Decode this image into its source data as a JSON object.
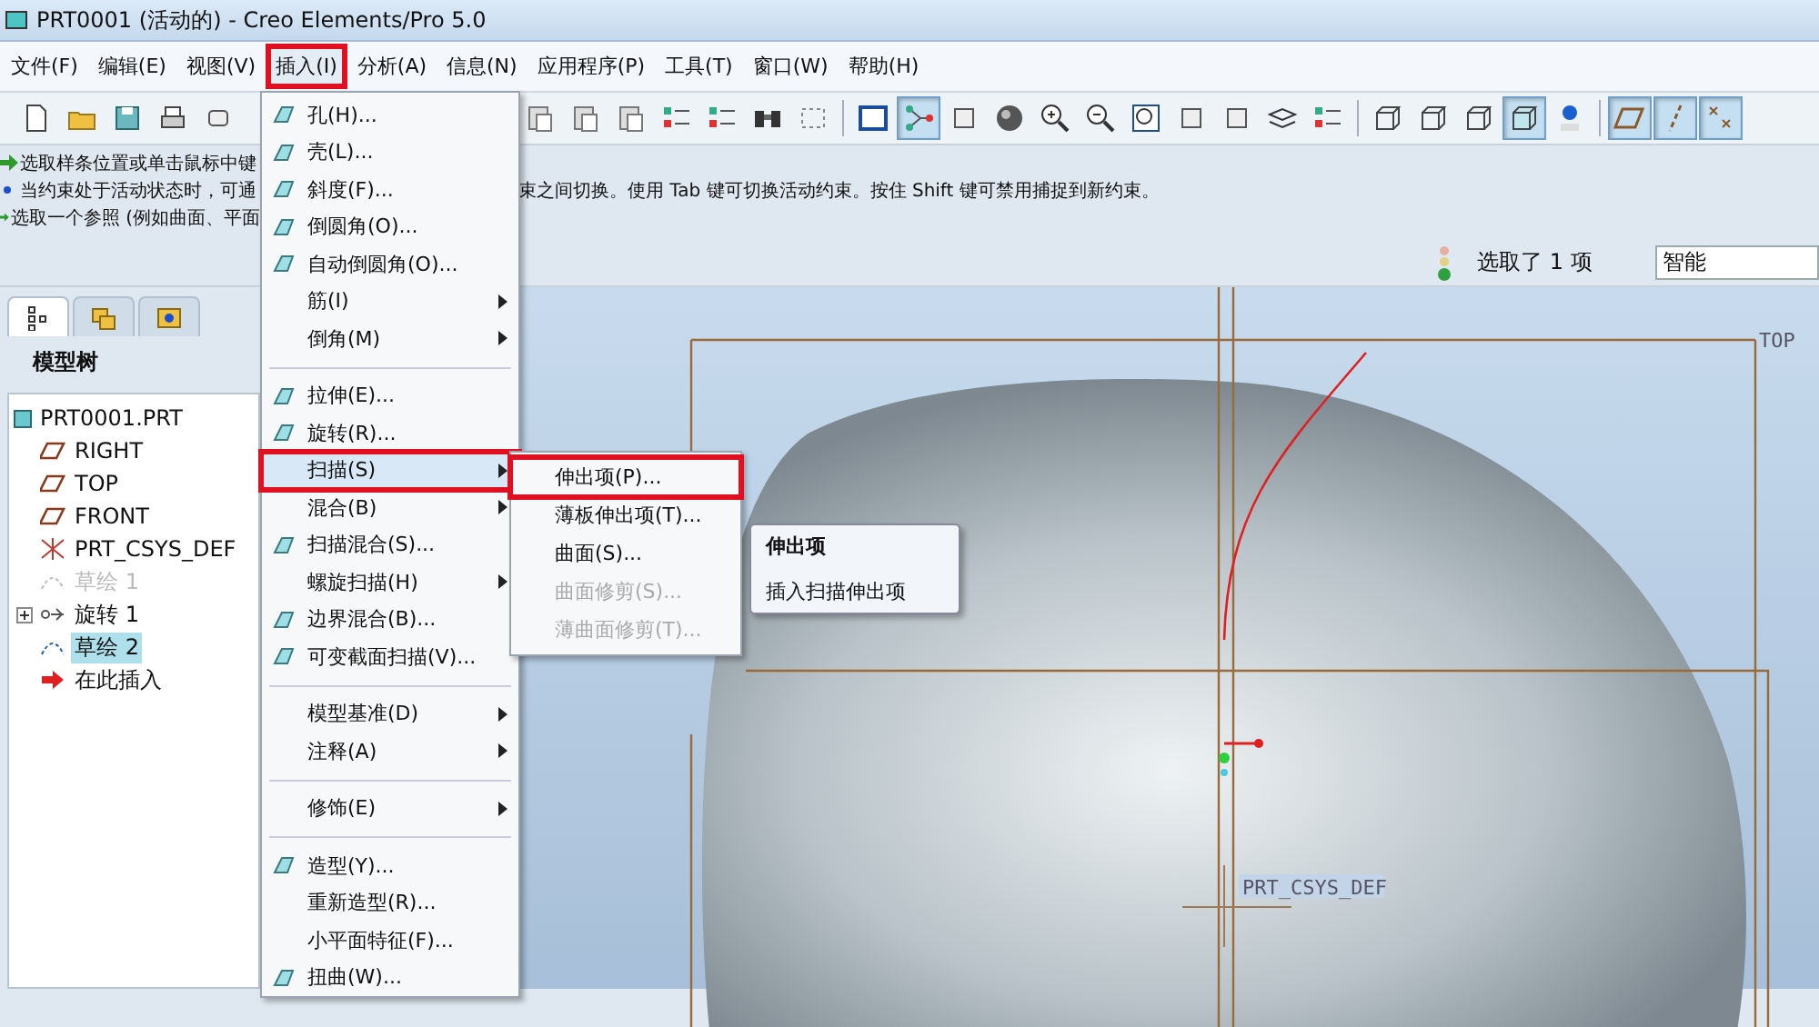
{
  "window": {
    "title": "PRT0001 (活动的) - Creo Elements/Pro 5.0"
  },
  "menubar": [
    {
      "label": "文件(F)",
      "selected": false,
      "annotated": false
    },
    {
      "label": "编辑(E)",
      "selected": false,
      "annotated": false
    },
    {
      "label": "视图(V)",
      "selected": false,
      "annotated": false
    },
    {
      "label": "插入(I)",
      "selected": true,
      "annotated": true
    },
    {
      "label": "分析(A)",
      "selected": false,
      "annotated": false
    },
    {
      "label": "信息(N)",
      "selected": false,
      "annotated": false
    },
    {
      "label": "应用程序(P)",
      "selected": false,
      "annotated": false
    },
    {
      "label": "工具(T)",
      "selected": false,
      "annotated": false
    },
    {
      "label": "窗口(W)",
      "selected": false,
      "annotated": false
    },
    {
      "label": "帮助(H)",
      "selected": false,
      "annotated": false
    }
  ],
  "toolbar_left": [
    {
      "kind": "doc",
      "pressed": false
    },
    {
      "kind": "folder",
      "pressed": false
    },
    {
      "kind": "disk",
      "pressed": false
    },
    {
      "kind": "printer",
      "pressed": false
    },
    {
      "kind": "generic",
      "pressed": false
    }
  ],
  "toolbar_right": [
    {
      "kind": "clipboard",
      "pressed": false
    },
    {
      "kind": "clipboard",
      "pressed": false
    },
    {
      "kind": "clipboard",
      "pressed": false
    },
    {
      "kind": "list",
      "pressed": false
    },
    {
      "kind": "list",
      "pressed": false
    },
    {
      "kind": "binoculars",
      "pressed": false
    },
    {
      "kind": "selectbox",
      "pressed": false
    },
    {
      "kind": "sep"
    },
    {
      "kind": "window",
      "pressed": false
    },
    {
      "kind": "datum",
      "pressed": true
    },
    {
      "kind": "generic",
      "pressed": false
    },
    {
      "kind": "sphere",
      "pressed": false
    },
    {
      "kind": "zoomin",
      "pressed": false
    },
    {
      "kind": "zoomout",
      "pressed": false
    },
    {
      "kind": "zoombox",
      "pressed": false
    },
    {
      "kind": "generic",
      "pressed": false
    },
    {
      "kind": "generic",
      "pressed": false
    },
    {
      "kind": "layers",
      "pressed": false
    },
    {
      "kind": "list",
      "pressed": false
    },
    {
      "kind": "sep"
    },
    {
      "kind": "cubewire",
      "pressed": false
    },
    {
      "kind": "cubewire",
      "pressed": false
    },
    {
      "kind": "cubewire",
      "pressed": false
    },
    {
      "kind": "cubeshaded",
      "pressed": true
    },
    {
      "kind": "pin",
      "pressed": false
    },
    {
      "kind": "sep"
    },
    {
      "kind": "plane",
      "pressed": true
    },
    {
      "kind": "axis",
      "pressed": true
    },
    {
      "kind": "point",
      "pressed": true
    }
  ],
  "messages": [
    {
      "kind": "arrow",
      "left": "选取样条位置或单击鼠标中键"
    },
    {
      "kind": "bullet",
      "left": "当约束处于活动状态时，可通",
      "right": "束之间切换。使用 Tab 键可切换活动约束。按住 Shift 键可禁用捕捉到新约束。"
    },
    {
      "kind": "arrow",
      "left": "选取一个参照 (例如曲面、平面"
    }
  ],
  "status": {
    "selection": "选取了 1 项",
    "filter": "智能"
  },
  "model_tree": {
    "tabs": [
      {
        "kind": "tree",
        "selected": true
      },
      {
        "kind": "folders",
        "selected": false
      },
      {
        "kind": "favorites",
        "selected": false
      }
    ],
    "title": "模型树",
    "root": {
      "label": "PRT0001.PRT",
      "children": [
        {
          "label": "RIGHT",
          "kind": "plane",
          "expandable": false,
          "selected": false,
          "suppressed": false
        },
        {
          "label": "TOP",
          "kind": "plane",
          "expandable": false,
          "selected": false,
          "suppressed": false
        },
        {
          "label": "FRONT",
          "kind": "plane",
          "expandable": false,
          "selected": false,
          "suppressed": false
        },
        {
          "label": "PRT_CSYS_DEF",
          "kind": "csys",
          "expandable": false,
          "selected": false,
          "suppressed": false
        },
        {
          "label": "草绘 1",
          "kind": "sketch",
          "expandable": false,
          "selected": false,
          "suppressed": true
        },
        {
          "label": "旋转 1",
          "kind": "revolve",
          "expandable": true,
          "selected": false,
          "suppressed": false
        },
        {
          "label": "草绘 2",
          "kind": "sketch",
          "expandable": false,
          "selected": true,
          "suppressed": false
        },
        {
          "label": "在此插入",
          "kind": "insert",
          "expandable": false,
          "selected": false,
          "suppressed": false
        }
      ]
    }
  },
  "insert_menu": [
    {
      "kind": "icon",
      "label": "孔(H)...",
      "submenu": false,
      "selected": false,
      "annotated": false
    },
    {
      "kind": "icon",
      "label": "壳(L)...",
      "submenu": false,
      "selected": false,
      "annotated": false
    },
    {
      "kind": "icon",
      "label": "斜度(F)...",
      "submenu": false,
      "selected": false,
      "annotated": false
    },
    {
      "kind": "icon",
      "label": "倒圆角(O)...",
      "submenu": false,
      "selected": false,
      "annotated": false
    },
    {
      "kind": "icon",
      "label": "自动倒圆角(O)...",
      "submenu": false,
      "selected": false,
      "annotated": false
    },
    {
      "kind": "plain",
      "label": "筋(I)",
      "submenu": true,
      "selected": false,
      "annotated": false
    },
    {
      "kind": "plain",
      "label": "倒角(M)",
      "submenu": true,
      "selected": false,
      "annotated": false
    },
    {
      "kind": "separator"
    },
    {
      "kind": "icon",
      "label": "拉伸(E)...",
      "submenu": false,
      "selected": false,
      "annotated": false
    },
    {
      "kind": "icon",
      "label": "旋转(R)...",
      "submenu": false,
      "selected": false,
      "annotated": false
    },
    {
      "kind": "plain",
      "label": "扫描(S)",
      "submenu": true,
      "selected": true,
      "annotated": true
    },
    {
      "kind": "plain",
      "label": "混合(B)",
      "submenu": true,
      "selected": false,
      "annotated": false
    },
    {
      "kind": "icon",
      "label": "扫描混合(S)...",
      "submenu": false,
      "selected": false,
      "annotated": false
    },
    {
      "kind": "plain",
      "label": "螺旋扫描(H)",
      "submenu": true,
      "selected": false,
      "annotated": false
    },
    {
      "kind": "icon",
      "label": "边界混合(B)...",
      "submenu": false,
      "selected": false,
      "annotated": false
    },
    {
      "kind": "icon",
      "label": "可变截面扫描(V)...",
      "submenu": false,
      "selected": false,
      "annotated": false
    },
    {
      "kind": "separator"
    },
    {
      "kind": "plain",
      "label": "模型基准(D)",
      "submenu": true,
      "selected": false,
      "annotated": false
    },
    {
      "kind": "plain",
      "label": "注释(A)",
      "submenu": true,
      "selected": false,
      "annotated": false
    },
    {
      "kind": "separator"
    },
    {
      "kind": "plain",
      "label": "修饰(E)",
      "submenu": true,
      "selected": false,
      "annotated": false
    },
    {
      "kind": "separator"
    },
    {
      "kind": "icon",
      "label": "造型(Y)...",
      "submenu": false,
      "selected": false,
      "annotated": false
    },
    {
      "kind": "plain",
      "label": "重新造型(R)...",
      "submenu": false,
      "selected": false,
      "annotated": false
    },
    {
      "kind": "plain",
      "label": "小平面特征(F)...",
      "submenu": false,
      "selected": false,
      "annotated": false
    },
    {
      "kind": "icon",
      "label": "扭曲(W)...",
      "submenu": false,
      "selected": false,
      "annotated": false
    }
  ],
  "sweep_submenu": [
    {
      "label": "伸出项(P)...",
      "disabled": false,
      "annotated": true
    },
    {
      "label": "薄板伸出项(T)...",
      "disabled": false,
      "annotated": false
    },
    {
      "label": "曲面(S)...",
      "disabled": false,
      "annotated": false
    },
    {
      "label": "曲面修剪(S)...",
      "disabled": true,
      "annotated": false
    },
    {
      "label": "薄曲面修剪(T)...",
      "disabled": true,
      "annotated": false
    }
  ],
  "tooltip": {
    "title": "伸出项",
    "text": "插入扫描伸出项"
  },
  "viewport": {
    "plane_label": "TOP",
    "csys_label": "PRT_CSYS_DEF"
  }
}
